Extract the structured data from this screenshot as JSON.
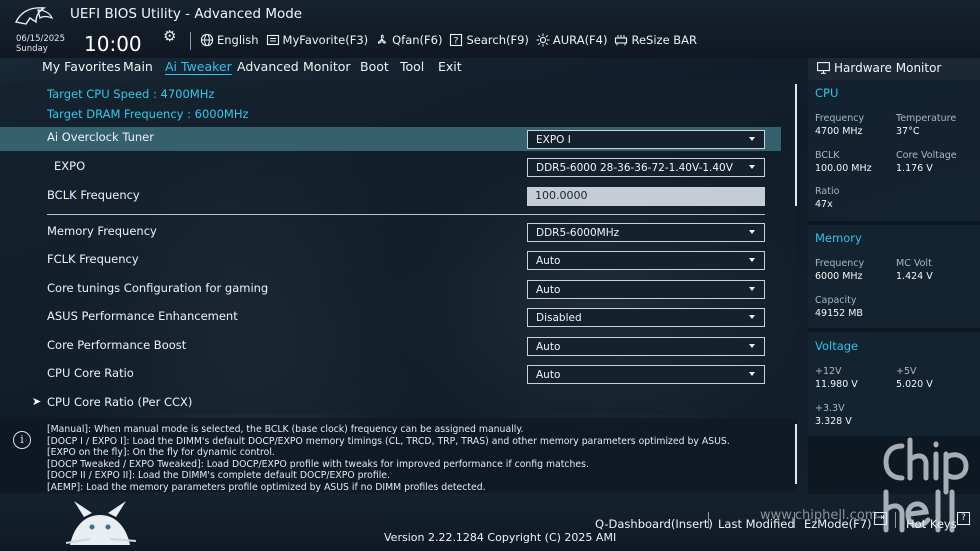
{
  "header": {
    "app_title": "UEFI BIOS Utility - Advanced Mode",
    "date": "06/15/2025",
    "weekday": "Sunday",
    "time": "10:00",
    "tools": [
      {
        "icon": "globe-icon",
        "label": "English"
      },
      {
        "icon": "star-folder-icon",
        "label": "MyFavorite(F3)"
      },
      {
        "icon": "fan-icon",
        "label": "Qfan(F6)"
      },
      {
        "icon": "question-box-icon",
        "label": "Search(F9)"
      },
      {
        "icon": "aura-light-icon",
        "label": "AURA(F4)"
      },
      {
        "icon": "resize-bar-icon",
        "label": "ReSize BAR"
      }
    ]
  },
  "menu": {
    "items": [
      "My Favorites",
      "Main",
      "Ai Tweaker",
      "Advanced",
      "Monitor",
      "Boot",
      "Tool",
      "Exit"
    ],
    "active": "Ai Tweaker"
  },
  "main": {
    "info": [
      "Target CPU Speed : 4700MHz",
      "Target DRAM Frequency : 6000MHz"
    ],
    "settings": [
      {
        "label": "Ai Overclock Tuner",
        "value": "EXPO I",
        "type": "dropdown"
      },
      {
        "label": "EXPO",
        "value": "DDR5-6000 28-36-36-72-1.40V-1.40V",
        "type": "dropdown"
      },
      {
        "label": "BCLK Frequency",
        "value": "100.0000",
        "type": "text"
      },
      {
        "label": "Memory Frequency",
        "value": "DDR5-6000MHz",
        "type": "dropdown"
      },
      {
        "label": "FCLK Frequency",
        "value": "Auto",
        "type": "dropdown"
      },
      {
        "label": "Core tunings Configuration for gaming",
        "value": "Auto",
        "type": "dropdown"
      },
      {
        "label": "ASUS Performance Enhancement",
        "value": "Disabled",
        "type": "dropdown"
      },
      {
        "label": "Core Performance Boost",
        "value": "Auto",
        "type": "dropdown"
      },
      {
        "label": "CPU Core Ratio",
        "value": "Auto",
        "type": "dropdown"
      }
    ],
    "submenu": "CPU Core Ratio (Per CCX)"
  },
  "help": {
    "lines": [
      "[Manual]: When manual mode is selected, the BCLK (base clock) frequency can be assigned manually.",
      "[DOCP I / EXPO I]:  Load the DIMM's default DOCP/EXPO memory timings (CL, TRCD, TRP, TRAS) and other memory parameters optimized by ASUS.",
      "[EXPO on the fly]: On the fly for dynamic control.",
      "[DOCP Tweaked / EXPO Tweaked]: Load DOCP/EXPO profile with tweaks for improved performance if config matches.",
      "[DOCP II / EXPO II]:  Load the DIMM's complete default DOCP/EXPO profile.",
      "[AEMP]: Load the memory parameters profile optimized by ASUS if no DIMM profiles detected."
    ]
  },
  "hardware_monitor": {
    "title": "Hardware Monitor",
    "cpu": {
      "title": "CPU",
      "frequency_label": "Frequency",
      "frequency": "4700 MHz",
      "temperature_label": "Temperature",
      "temperature": "37°C",
      "bclk_label": "BCLK",
      "bclk": "100.00 MHz",
      "core_voltage_label": "Core Voltage",
      "core_voltage": "1.176 V",
      "ratio_label": "Ratio",
      "ratio": "47x"
    },
    "memory": {
      "title": "Memory",
      "frequency_label": "Frequency",
      "frequency": "6000 MHz",
      "mc_volt_label": "MC Volt",
      "mc_volt": "1.424 V",
      "capacity_label": "Capacity",
      "capacity": "49152 MB"
    },
    "voltage": {
      "title": "Voltage",
      "v12_label": "+12V",
      "v12": "11.980 V",
      "v5_label": "+5V",
      "v5": "5.020 V",
      "v33_label": "+3.3V",
      "v33": "3.328 V"
    }
  },
  "bottom": {
    "qdashboard": "Q-Dashboard(Insert)",
    "last_modified": "Last Modified",
    "ezmode": "EzMode(F7)",
    "hotkeys": "Hot Keys",
    "hotkeys_key": "?",
    "version": "Version 2.22.1284 Copyright (C) 2025 AMI",
    "watermark": "www.chiphell.com"
  },
  "colors": {
    "accent": "#2ec3e8",
    "highlight_row": "#35606d",
    "background": "#0d1824"
  }
}
